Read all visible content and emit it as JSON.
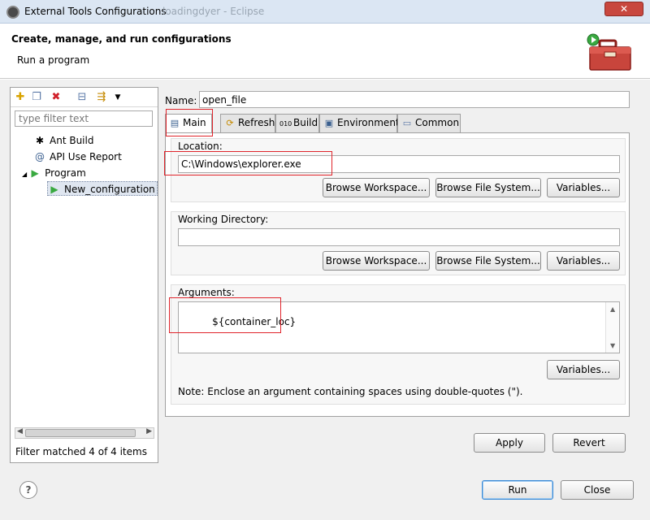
{
  "window": {
    "title": "External Tools Configurations",
    "background_title": "loadingdyer - Eclipse",
    "close_label": "✕"
  },
  "header": {
    "title": "Create, manage, and run configurations",
    "subtitle": "Run a program"
  },
  "left_panel": {
    "toolbar_icons": [
      "new-config-icon",
      "duplicate-icon",
      "delete-icon",
      "collapse-all-icon",
      "filter-icon",
      "dropdown-icon"
    ],
    "filter_placeholder": "type filter text",
    "tree": [
      {
        "label": "Ant Build",
        "icon": "ant-icon",
        "level": 1
      },
      {
        "label": "API Use Report",
        "icon": "api-icon",
        "level": 1
      },
      {
        "label": "Program",
        "icon": "program-icon",
        "level": 1,
        "expanded": true
      },
      {
        "label": "New_configuration",
        "icon": "program-config-icon",
        "level": 2,
        "selected": true
      }
    ],
    "filter_status": "Filter matched 4 of 4 items"
  },
  "form": {
    "name_label": "Name:",
    "name_value": "open_file",
    "tabs": [
      {
        "label": "Main",
        "icon": "main-tab-icon",
        "active": true
      },
      {
        "label": "Refresh",
        "icon": "refresh-tab-icon"
      },
      {
        "label": "Build",
        "icon": "build-tab-icon"
      },
      {
        "label": "Environment",
        "icon": "environment-tab-icon"
      },
      {
        "label": "Common",
        "icon": "common-tab-icon"
      }
    ],
    "location": {
      "label": "Location:",
      "value": "C:\\Windows\\explorer.exe",
      "buttons": [
        "Browse Workspace...",
        "Browse File System...",
        "Variables..."
      ]
    },
    "working_directory": {
      "label": "Working Directory:",
      "value": "",
      "buttons": [
        "Browse Workspace...",
        "Browse File System...",
        "Variables..."
      ]
    },
    "arguments": {
      "label": "Arguments:",
      "value": "${container_loc}",
      "variables_button": "Variables..."
    },
    "note": "Note: Enclose an argument containing spaces using double-quotes (\")."
  },
  "actions": {
    "apply": "Apply",
    "revert": "Revert",
    "run": "Run",
    "close": "Close",
    "help": "?"
  },
  "colors": {
    "highlight": "#e0242b",
    "titlebar": "#dbe6f3",
    "close_button": "#c8473e"
  }
}
